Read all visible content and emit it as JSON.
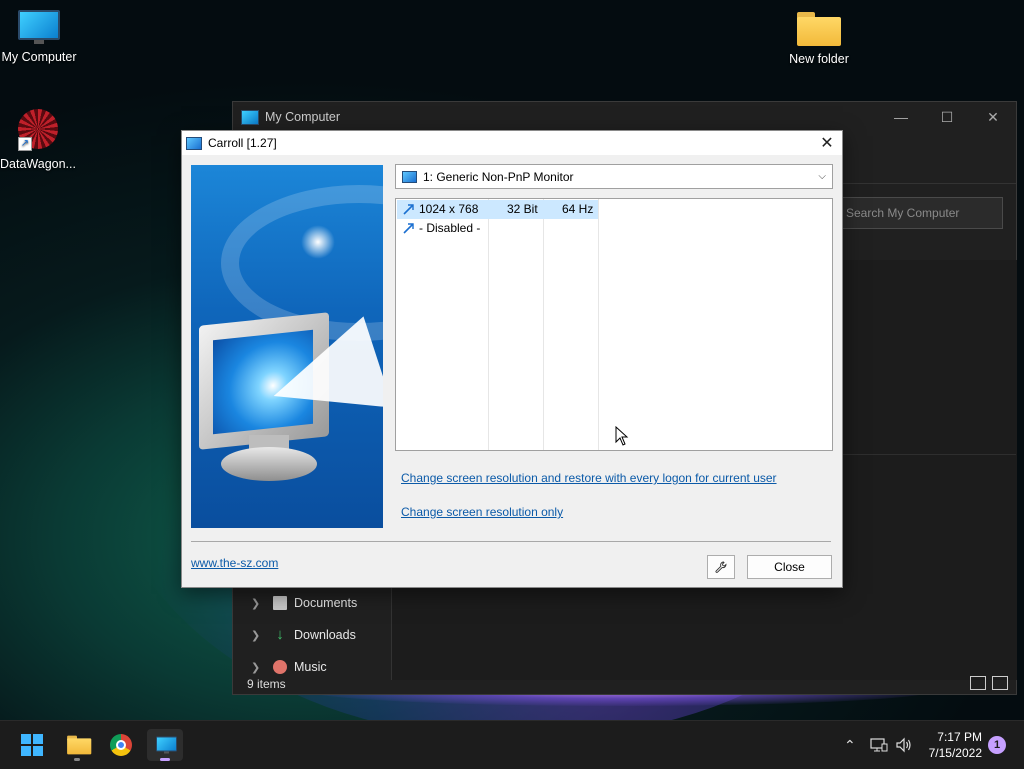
{
  "desktop": {
    "icons": [
      {
        "label": "My Computer"
      },
      {
        "label": "New folder"
      },
      {
        "label": "DataWagon..."
      }
    ]
  },
  "explorer": {
    "title": "My Computer",
    "search_placeholder": "Search My Computer",
    "nav": [
      {
        "label": "Documents"
      },
      {
        "label": "Downloads"
      },
      {
        "label": "Music"
      }
    ],
    "status": "9 items"
  },
  "dialog": {
    "title": "Carroll [1.27]",
    "monitor_select": "1: Generic Non-PnP Monitor",
    "resolutions": [
      {
        "resolution": "1024 x 768",
        "depth": "32 Bit",
        "refresh": "64 Hz",
        "selected": true
      },
      {
        "resolution": "- Disabled -",
        "depth": "",
        "refresh": "",
        "selected": false
      }
    ],
    "link_restore": "Change screen resolution and restore with every logon for current user",
    "link_only": "Change screen resolution only",
    "website": "www.the-sz.com",
    "close_button": "Close"
  },
  "taskbar": {
    "time": "7:17 PM",
    "date": "7/15/2022",
    "notification_count": "1"
  },
  "colors": {
    "accent": "#0b5aa8",
    "selection": "#cce8ff",
    "taskbar_indicator": "#c6a0ff"
  }
}
